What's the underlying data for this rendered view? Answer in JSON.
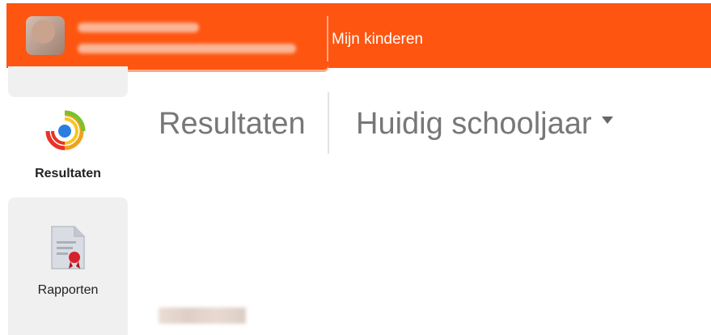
{
  "topbar": {
    "kids_link": "Mijn kinderen",
    "accent": "#fe5510"
  },
  "sidebar": {
    "items": [
      {
        "label": "Resultaten",
        "icon": "results-target-icon",
        "active": true
      },
      {
        "label": "Rapporten",
        "icon": "report-certificate-icon",
        "active": false
      }
    ]
  },
  "header": {
    "title": "Resultaten",
    "period_selected": "Huidig schooljaar",
    "period_icon": "caret-down-icon"
  }
}
